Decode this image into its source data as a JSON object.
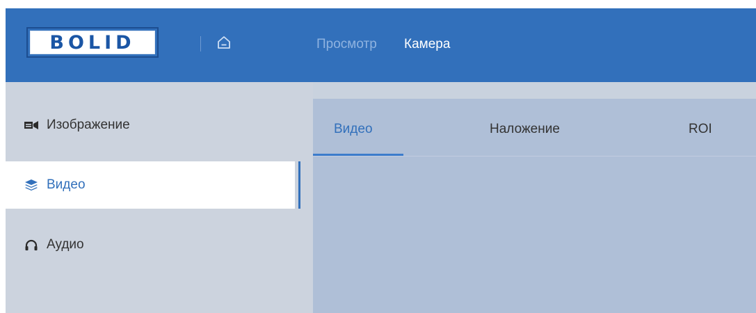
{
  "header": {
    "logo_text": "BOLID",
    "home_icon": "home-icon",
    "nav": [
      {
        "label": "Просмотр",
        "active": false
      },
      {
        "label": "Камера",
        "active": true
      }
    ]
  },
  "sidebar": {
    "items": [
      {
        "label": "Изображение",
        "icon": "camera-icon",
        "active": false
      },
      {
        "label": "Видео",
        "icon": "layers-icon",
        "active": true
      },
      {
        "label": "Аудио",
        "icon": "headphones-icon",
        "active": false
      }
    ]
  },
  "content": {
    "tabs": [
      {
        "label": "Видео",
        "active": true
      },
      {
        "label": "Наложение",
        "active": false
      },
      {
        "label": "ROI",
        "active": false
      }
    ]
  },
  "colors": {
    "header_bg": "#3270bb",
    "sidebar_bg": "#ccd3de",
    "content_bg": "#afbfd7",
    "accent": "#3270bb",
    "inactive_nav": "#8fb3e0",
    "text": "#333333"
  }
}
